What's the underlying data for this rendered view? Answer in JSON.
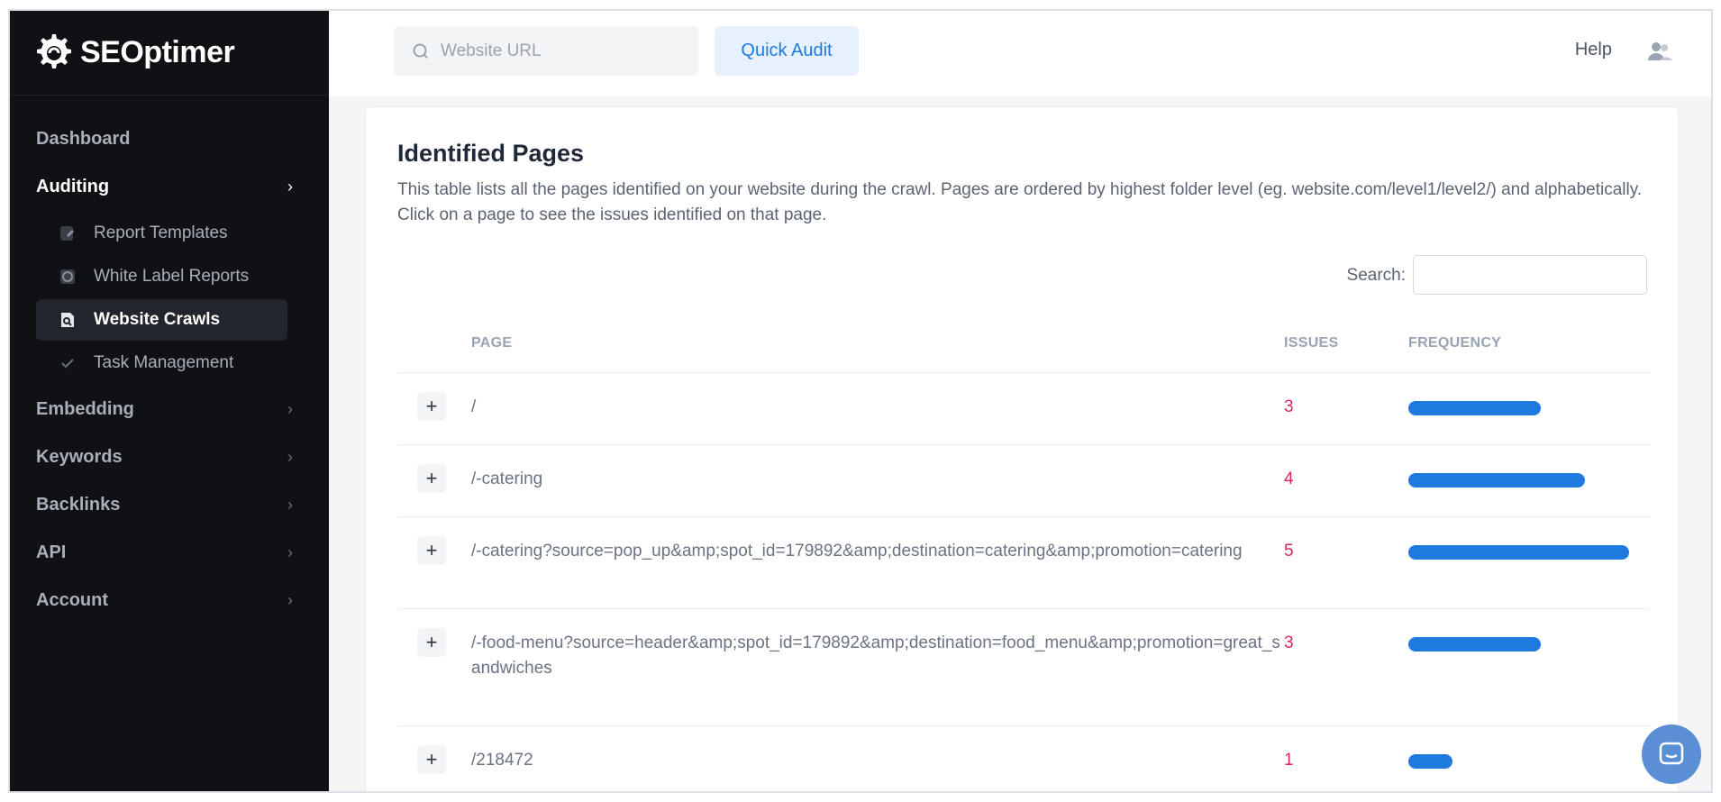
{
  "app": {
    "brand": "SEOptimer"
  },
  "sidebar": {
    "items": [
      {
        "label": "Dashboard"
      },
      {
        "label": "Auditing"
      },
      {
        "label": "Embedding"
      },
      {
        "label": "Keywords"
      },
      {
        "label": "Backlinks"
      },
      {
        "label": "API"
      },
      {
        "label": "Account"
      }
    ],
    "auditing_sub": [
      {
        "label": "Report Templates",
        "icon": "document-edit-icon"
      },
      {
        "label": "White Label Reports",
        "icon": "clock-doc-icon"
      },
      {
        "label": "Website Crawls",
        "icon": "search-doc-icon"
      },
      {
        "label": "Task Management",
        "icon": "check-icon"
      }
    ]
  },
  "header": {
    "search_placeholder": "Website URL",
    "quick_audit_label": "Quick Audit",
    "help_label": "Help"
  },
  "main": {
    "title": "Identified Pages",
    "description": "This table lists all the pages identified on your website during the crawl. Pages are ordered by highest folder level (eg. website.com/level1/level2/) and alphabetically. Click on a page to see the issues identified on that page.",
    "search_label": "Search:",
    "table": {
      "columns": [
        "PAGE",
        "ISSUES",
        "FREQUENCY"
      ],
      "max_issues": 5,
      "rows": [
        {
          "page": "/",
          "issues": 3
        },
        {
          "page": "/-catering",
          "issues": 4
        },
        {
          "page": "/-catering?source=pop_up&amp;spot_id=179892&amp;destination=catering&amp;promotion=catering",
          "issues": 5
        },
        {
          "page": "/-food-menu?source=header&amp;spot_id=179892&amp;destination=food_menu&amp;promotion=great_sandwiches",
          "issues": 3
        },
        {
          "page": "/218472",
          "issues": 1
        }
      ]
    }
  },
  "colors": {
    "accent": "#1f7ae0",
    "issues": "#e0245e",
    "sidebar_bg": "#0f1115"
  }
}
